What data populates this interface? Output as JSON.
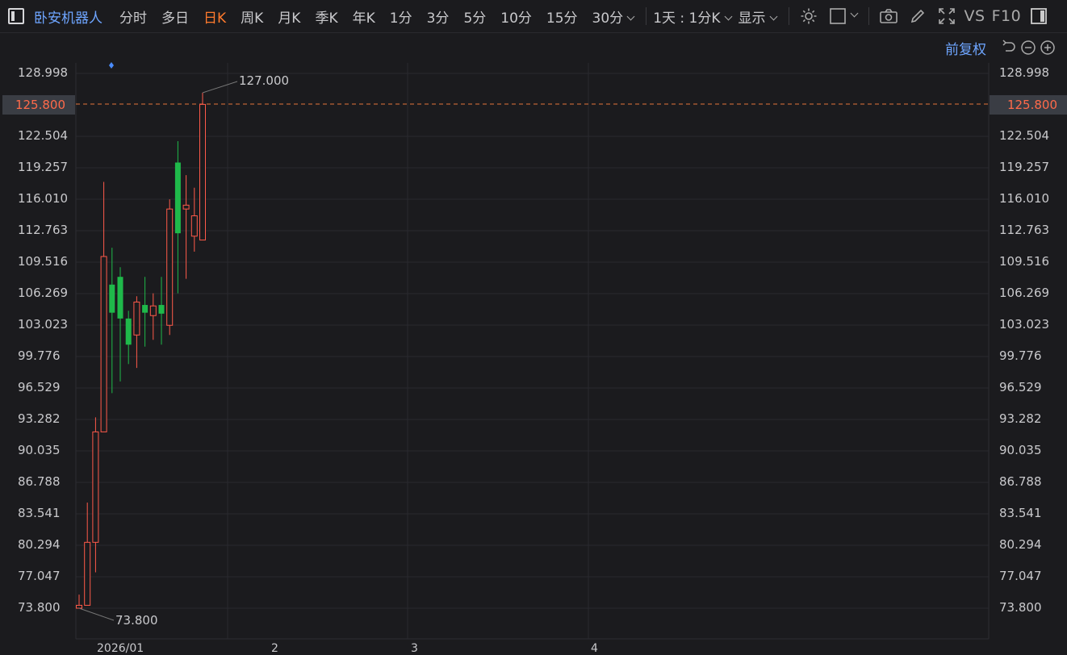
{
  "toolbar": {
    "stock_name": "卧安机器人",
    "periods": [
      "分时",
      "多日",
      "日K",
      "周K",
      "月K",
      "季K",
      "年K",
      "1分",
      "3分",
      "5分",
      "10分",
      "15分",
      "30分"
    ],
    "active_period": "日K",
    "range_select": "1天 : 1分K",
    "display_label": "显示",
    "vs_label": "VS",
    "f10_label": "F10",
    "icons": [
      "settings-icon",
      "layout-icon",
      "camera-icon",
      "pen-icon",
      "fullscreen-icon",
      "sidebar-icon"
    ]
  },
  "subbar": {
    "adjust_label": "前复权",
    "icons": [
      "undo-icon",
      "zoom-out-icon",
      "zoom-in-icon"
    ]
  },
  "chart_data": {
    "type": "candlestick",
    "y_ticks": [
      "128.998",
      "125.800",
      "122.504",
      "119.257",
      "116.010",
      "112.763",
      "109.516",
      "106.269",
      "103.023",
      "99.776",
      "96.529",
      "93.282",
      "90.035",
      "86.788",
      "83.541",
      "80.294",
      "77.047",
      "73.800"
    ],
    "current_price": "125.800",
    "max_label": "127.000",
    "min_label": "73.800",
    "x_labels": [
      "2026/01",
      "2",
      "3",
      "4"
    ],
    "up_color": "#ff5a4a",
    "down_color": "#1fb94a",
    "candles": [
      {
        "o": 73.8,
        "c": 74.1,
        "h": 75.2,
        "l": 73.8
      },
      {
        "o": 74.1,
        "c": 80.6,
        "h": 84.7,
        "l": 74.1
      },
      {
        "o": 80.6,
        "c": 92.0,
        "h": 93.5,
        "l": 77.5
      },
      {
        "o": 92.0,
        "c": 110.1,
        "h": 117.8,
        "l": 92.0
      },
      {
        "o": 107.2,
        "c": 104.3,
        "h": 111.0,
        "l": 96.0
      },
      {
        "o": 108.0,
        "c": 103.7,
        "h": 109.0,
        "l": 97.2
      },
      {
        "o": 103.7,
        "c": 101.0,
        "h": 104.5,
        "l": 99.0
      },
      {
        "o": 102.0,
        "c": 105.4,
        "h": 106.0,
        "l": 98.6
      },
      {
        "o": 105.1,
        "c": 104.3,
        "h": 108.0,
        "l": 100.8
      },
      {
        "o": 104.0,
        "c": 105.0,
        "h": 106.3,
        "l": 101.5
      },
      {
        "o": 105.1,
        "c": 104.2,
        "h": 108.0,
        "l": 101.0
      },
      {
        "o": 103.0,
        "c": 115.0,
        "h": 116.0,
        "l": 102.0
      },
      {
        "o": 119.8,
        "c": 112.5,
        "h": 122.0,
        "l": 106.3
      },
      {
        "o": 115.0,
        "c": 115.4,
        "h": 118.5,
        "l": 107.8
      },
      {
        "o": 112.2,
        "c": 114.3,
        "h": 117.2,
        "l": 110.6
      },
      {
        "o": 111.8,
        "c": 125.8,
        "h": 127.0,
        "l": 111.8
      }
    ]
  }
}
